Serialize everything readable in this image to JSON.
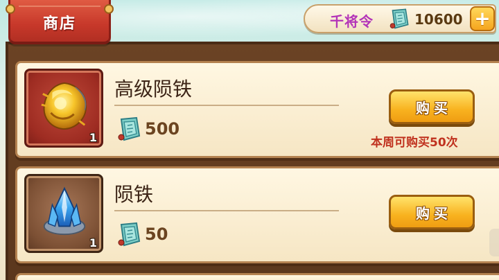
{
  "header": {
    "shop_tab_label": "商店"
  },
  "currency": {
    "label": "千将令",
    "value": "10600",
    "icon": "jade-token-icon",
    "plus_icon": "plus-icon"
  },
  "items": [
    {
      "name": "高级陨铁",
      "quantity": "1",
      "icon": "gold-meteor-iron-icon",
      "price": "500",
      "price_icon": "jade-token-icon",
      "buy_label": "购买",
      "limit_text": "本周可购买50次"
    },
    {
      "name": "陨铁",
      "quantity": "1",
      "icon": "blue-meteor-iron-icon",
      "price": "50",
      "price_icon": "jade-token-icon",
      "buy_label": "购买"
    }
  ],
  "colors": {
    "tab_red": "#c7382a",
    "currency_purple": "#b333b8",
    "limit_red": "#c0321f",
    "button_gold": "#f8b21f",
    "wood_brown": "#5b371d"
  }
}
